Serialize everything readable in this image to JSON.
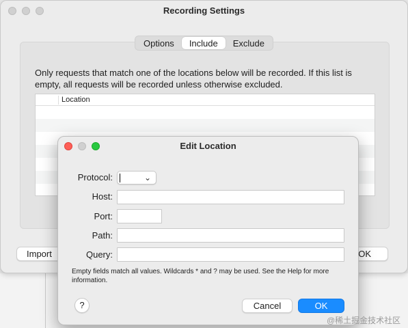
{
  "main_window": {
    "title": "Recording Settings",
    "tabs": [
      {
        "label": "Options",
        "active": false
      },
      {
        "label": "Include",
        "active": true
      },
      {
        "label": "Exclude",
        "active": false
      }
    ],
    "description": "Only requests that match one of the locations below will be recorded. If this list is empty, all requests will be recorded unless otherwise excluded.",
    "table": {
      "columns": [
        "",
        "Location"
      ],
      "rows": []
    },
    "buttons": {
      "import_label": "Import",
      "ok_label": "OK"
    }
  },
  "dialog": {
    "title": "Edit Location",
    "fields": {
      "protocol_label": "Protocol:",
      "protocol_value": "",
      "host_label": "Host:",
      "host_value": "",
      "port_label": "Port:",
      "port_value": "",
      "path_label": "Path:",
      "path_value": "",
      "query_label": "Query:",
      "query_value": ""
    },
    "note": "Empty fields match all values. Wildcards * and ? may be used. See the Help for more information.",
    "help_label": "?",
    "cancel_label": "Cancel",
    "ok_label": "OK"
  },
  "watermark": "@稀土掘金技术社区",
  "colors": {
    "accent": "#1a8cff",
    "close": "#fe5f57",
    "zoom": "#28c840"
  }
}
